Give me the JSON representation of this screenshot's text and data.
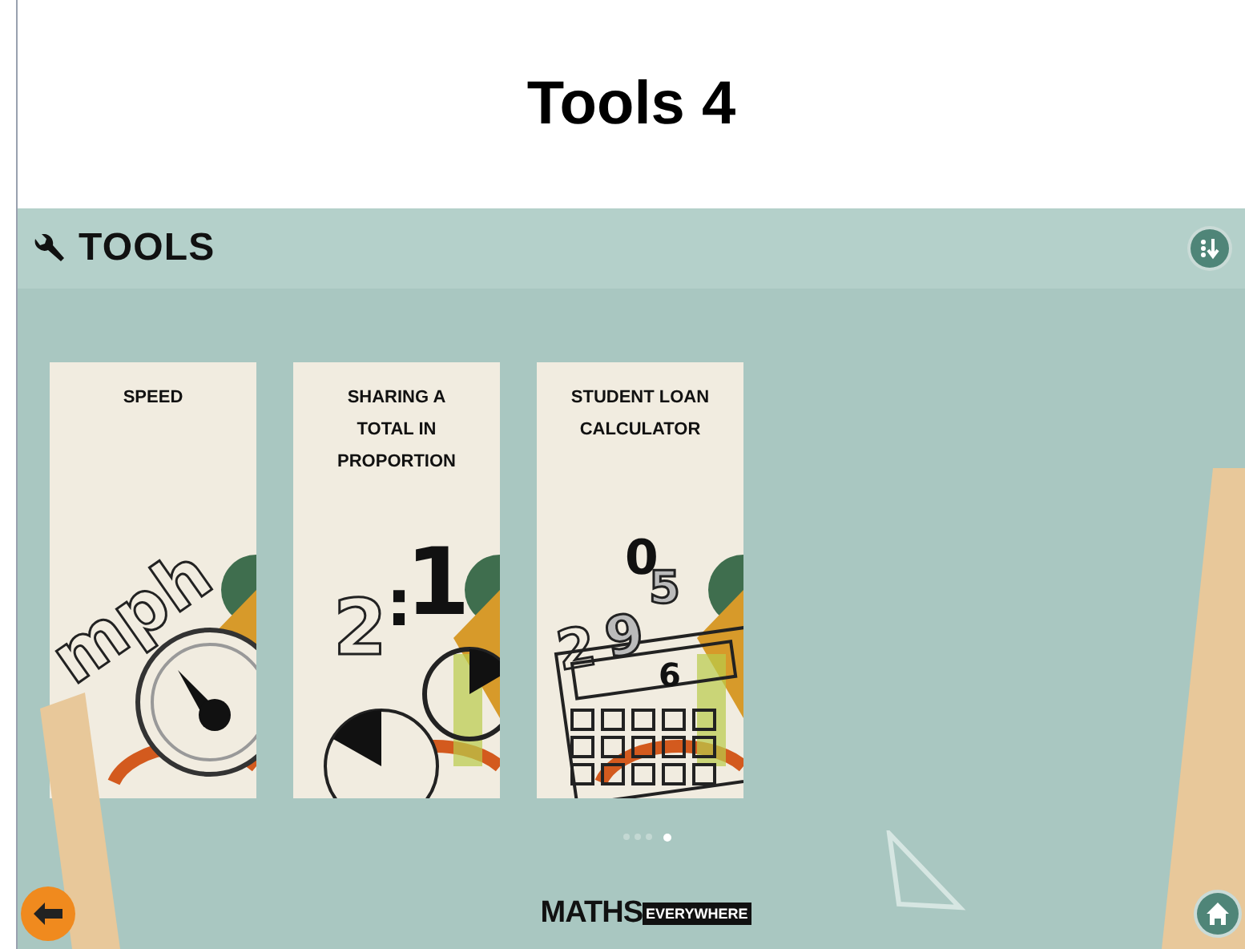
{
  "page_title": "Tools 4",
  "header": {
    "title": "TOOLS"
  },
  "cards": [
    {
      "kind": "speed",
      "title": "SPEED",
      "art_text": [
        "mph"
      ]
    },
    {
      "kind": "ratio",
      "title": "SHARING A TOTAL IN PROPORTION",
      "art_text": [
        "2",
        ":",
        "1"
      ]
    },
    {
      "kind": "calculator",
      "title": "STUDENT LOAN CALCULATOR",
      "art_text": [
        "0",
        "5",
        "2",
        "9",
        "6"
      ]
    }
  ],
  "pages": [
    {
      "selected": false
    },
    {
      "selected": false
    },
    {
      "selected": false
    },
    {
      "selected": true
    }
  ],
  "footer": {
    "logo_main": "MATHS",
    "logo_tag": "EVERYWHERE"
  }
}
